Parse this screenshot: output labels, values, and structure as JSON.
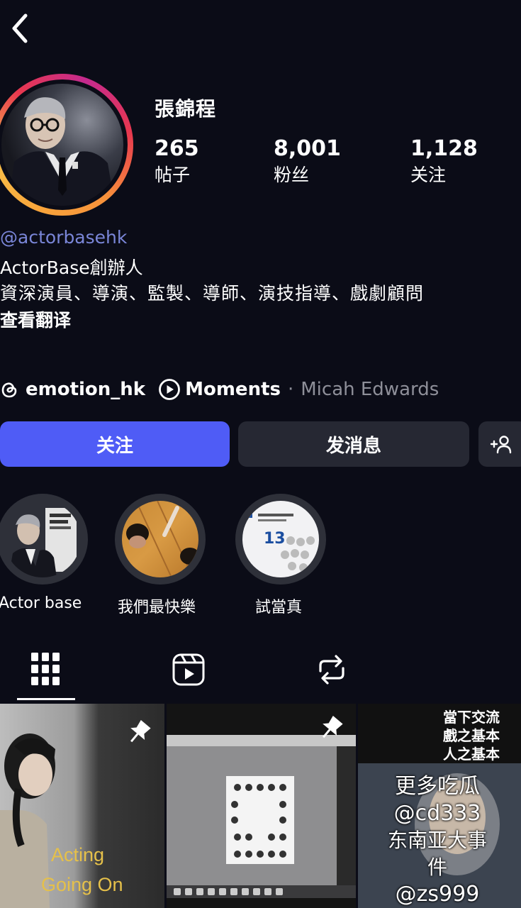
{
  "header": {
    "back_icon": "chevron-left-icon"
  },
  "profile": {
    "display_name": "張錦程",
    "stats": [
      {
        "value": "265",
        "label": "帖子"
      },
      {
        "value": "8,001",
        "label": "粉丝"
      },
      {
        "value": "1,128",
        "label": "关注"
      }
    ],
    "handle": "@actorbasehk",
    "bio_line1": "ActorBase創辦人",
    "bio_line2": "資深演員、導演、監製、導師、演技指導、戲劇顧問",
    "translate_link": "查看翻译",
    "threads_handle": "emotion_hk",
    "moments_label": "Moments",
    "separator": "·",
    "moments_artist": "Micah Edwards"
  },
  "actions": {
    "follow": "关注",
    "message": "发消息"
  },
  "highlights": [
    {
      "label": "Actor base"
    },
    {
      "label": "我們最快樂"
    },
    {
      "label": "試當真"
    }
  ],
  "highlight_text": {
    "poster_number": "13."
  },
  "tabs": [
    {
      "icon": "grid-icon",
      "active": true
    },
    {
      "icon": "reels-icon",
      "active": false
    },
    {
      "icon": "reposts-icon",
      "active": false
    }
  ],
  "posts": {
    "post1_caption_line1": "Acting",
    "post1_caption_line2": "Going On",
    "post3_caption_line1": "當下交流",
    "post3_caption_line2": "戲之基本",
    "post3_caption_line3": "人之基本"
  },
  "watermark": {
    "line1": "更多吃瓜",
    "line2": "@cd333",
    "line3": "东南亚大事件",
    "line4": "@zs999"
  },
  "colors": {
    "background": "#0b0c17",
    "follow_button": "#4f5cf6",
    "handle_link": "#7a86d8",
    "secondary_button": "#262833"
  }
}
